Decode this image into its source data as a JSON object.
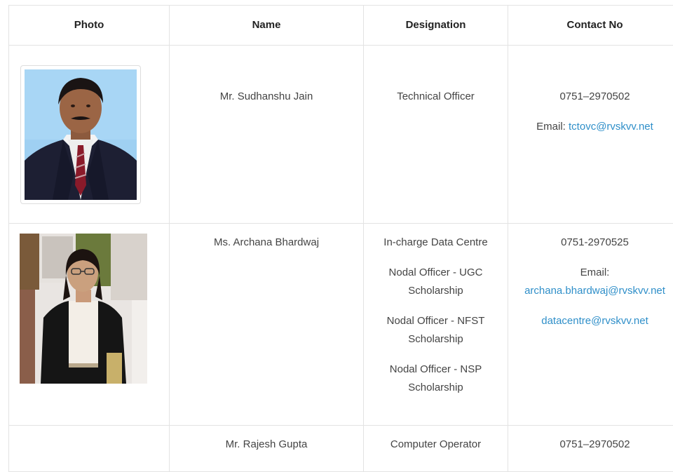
{
  "headers": {
    "photo": "Photo",
    "name": "Name",
    "designation": "Designation",
    "contact": "Contact No"
  },
  "rows": [
    {
      "name": "Mr. Sudhanshu Jain",
      "designations": [
        "Technical Officer"
      ],
      "phone": "0751–2970502",
      "email_label": "Email:",
      "emails": [
        "tctovc@rvskvv.net"
      ]
    },
    {
      "name": "Ms. Archana Bhardwaj",
      "designations": [
        "In-charge Data Centre",
        "Nodal Officer - UGC Scholarship",
        "Nodal Officer - NFST Scholarship",
        "Nodal Officer - NSP Scholarship"
      ],
      "phone": "0751-2970525",
      "email_label": "Email:",
      "emails": [
        "archana.bhardwaj@rvskvv.net",
        "datacentre@rvskvv.net"
      ]
    },
    {
      "name": "Mr. Rajesh Gupta",
      "designations": [
        "Computer Operator"
      ],
      "phone": "0751–2970502"
    }
  ],
  "colors": {
    "link": "#2f8fc9",
    "border": "#e3e3e3",
    "header_text": "#222222",
    "body_text": "#444444"
  }
}
